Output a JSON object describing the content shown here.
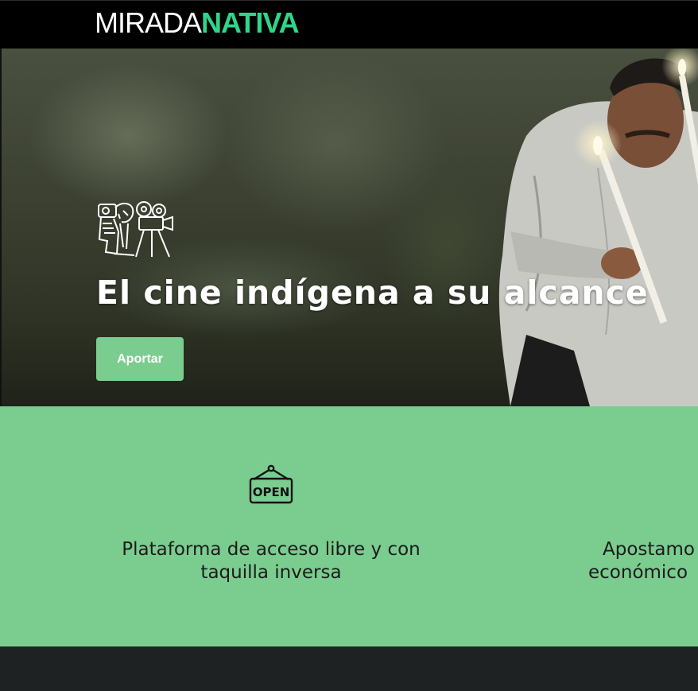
{
  "header": {
    "logo_part1": "MIRADA",
    "logo_part2": "NATIVA"
  },
  "hero": {
    "title": "El cine indígena a su alcance",
    "button_label": "Aportar"
  },
  "features": [
    {
      "icon": "open-sign-icon",
      "line1": "Plataforma de acceso libre y con",
      "line2": "taquilla inversa"
    },
    {
      "line1": "Apostamo",
      "line2": "económico"
    }
  ],
  "colors": {
    "accent": "#7bcd8f",
    "logo_green": "#2fd68a",
    "header_bg": "#000000",
    "footer_bg": "#1f2223"
  }
}
